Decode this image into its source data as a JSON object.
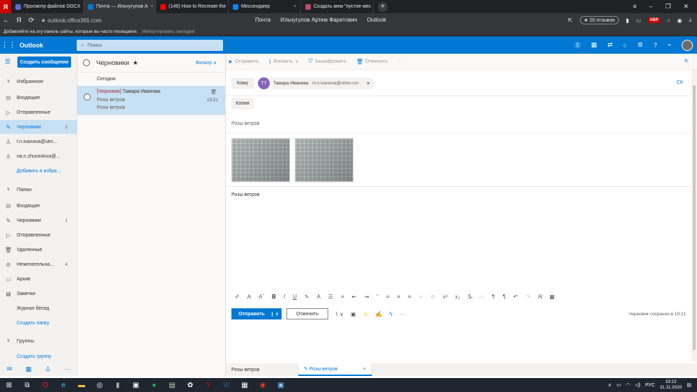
{
  "browser": {
    "tabs": [
      {
        "label": "Просмотр файлов DOCX",
        "color": "#5b6bd6"
      },
      {
        "label": "Почта — Ильчугулов А",
        "color": "#0078d4",
        "active": true
      },
      {
        "label": "(148) How to Recreate the",
        "color": "#ff0000"
      },
      {
        "label": "Мессенджер",
        "color": "#0a84ff"
      },
      {
        "label": "Создать мем \"пустое мес",
        "color": "#c04b6b"
      }
    ],
    "url": "outlook.office365.com",
    "center_title": [
      "Почта",
      "Ильчугулов Артем Фаритович",
      "Outlook"
    ],
    "reviews": "★ 20 отзывов",
    "bookmarks_text": "Добавляйте на эту панель сайты, которые вы часто посещаете.",
    "bookmarks_link": "Импортировать закладки"
  },
  "outlook": {
    "brand": "Outlook",
    "search_placeholder": "Поиск",
    "new_message": "Создать сообщение"
  },
  "nav": {
    "favorites_header": "Избранное",
    "favorites": [
      {
        "label": "Входящие",
        "icon": "inbox-icon"
      },
      {
        "label": "Отправленные",
        "icon": "send-icon"
      },
      {
        "label": "Черновики",
        "icon": "pencil-icon",
        "count": "1",
        "selected": true
      },
      {
        "label": "t.n.ivanova@utm...",
        "icon": "person-icon"
      },
      {
        "label": "na.n.zhuravlova@...",
        "icon": "person-icon"
      }
    ],
    "add_favorite": "Добавить в избра...",
    "folders_header": "Папки",
    "folders": [
      {
        "label": "Входящие",
        "icon": "inbox-icon"
      },
      {
        "label": "Черновики",
        "icon": "pencil-icon",
        "count": "1"
      },
      {
        "label": "Отправленные",
        "icon": "send-icon"
      },
      {
        "label": "Удаленные",
        "icon": "trash-icon"
      },
      {
        "label": "Нежелательна...",
        "icon": "blocked-icon",
        "count": "4"
      },
      {
        "label": "Архив",
        "icon": "archive-icon"
      },
      {
        "label": "Заметки",
        "icon": "note-icon"
      },
      {
        "label": "Журнал бесед",
        "icon": ""
      }
    ],
    "create_folder": "Создать папку",
    "groups_header": "Группы",
    "create_group": "Создать группу"
  },
  "list": {
    "title": "Черновики",
    "filter": "Фильтр",
    "group": "Сегодня",
    "messages": [
      {
        "draft_tag": "[Черновик]",
        "from": "Тамара Иванова",
        "subject": "Розы ветров",
        "preview": "Розы ветров",
        "time": "19:21"
      }
    ]
  },
  "cmdbar": {
    "send": "Отправить",
    "attach": "Вложить",
    "encrypt": "Зашифровать",
    "discard": "Отменить",
    "more": "···"
  },
  "compose": {
    "to_label": "Кому",
    "recipient_initials": "ТТ",
    "recipient_name": "Тамара Иванова",
    "recipient_email": "<t.n.ivanova@utmn.ru>",
    "cc_toggle": "СК",
    "cc_label": "Копия",
    "subject": "Розы ветров",
    "body": "Розы ветров",
    "send_label": "Отправить",
    "discard_label": "Отменить",
    "saved_status": "Черновик сохранен в 19:21"
  },
  "draft_tabs": [
    {
      "label": "Розы ветров"
    },
    {
      "label": "Розы ветров",
      "active": true
    }
  ],
  "taskbar": {
    "lang": "РУС",
    "time": "19:22",
    "date": "11.11.2020"
  }
}
